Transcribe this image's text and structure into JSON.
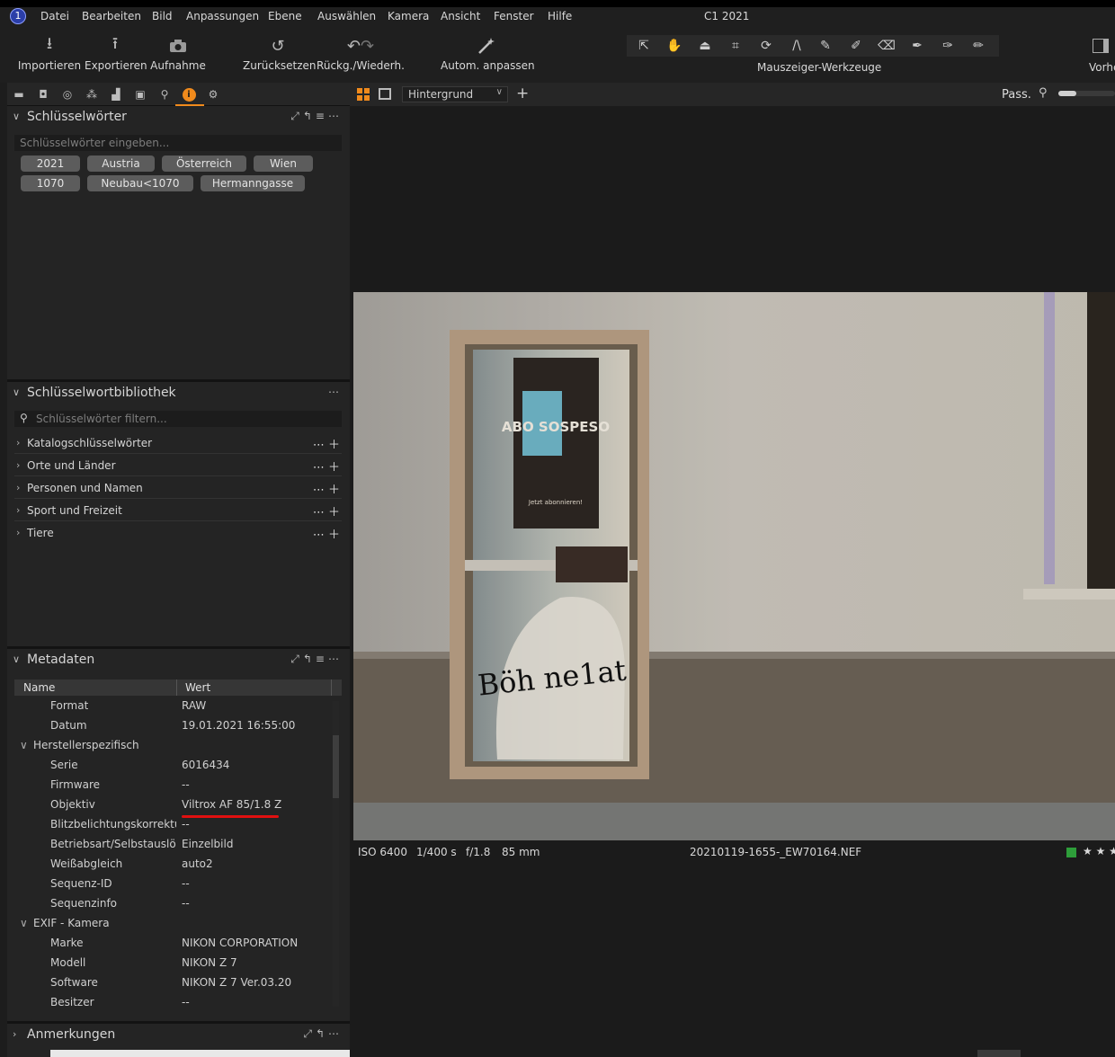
{
  "app": {
    "title": "C1 2021",
    "badge": "1"
  },
  "menu": [
    "Datei",
    "Bearbeiten",
    "Bild",
    "Anpassungen",
    "Ebene",
    "Auswählen",
    "Kamera",
    "Ansicht",
    "Fenster",
    "Hilfe"
  ],
  "toolbar": {
    "import": "Importieren",
    "export": "Exportieren",
    "capture": "Aufnahme",
    "reset": "Zurücksetzen",
    "undo_redo": "Rückg./Wiederh.",
    "auto_adjust": "Autom. anpassen",
    "cursor_tools": "Mauszeiger-Werkzeuge",
    "preview": "Vorhe"
  },
  "keywords": {
    "title": "Schlüsselwörter",
    "placeholder": "Schlüsselwörter eingeben...",
    "tags": [
      "2021",
      "Austria",
      "Österreich",
      "Wien",
      "1070",
      "Neubau<1070",
      "Hermanngasse"
    ]
  },
  "library": {
    "title": "Schlüsselwortbibliothek",
    "placeholder": "Schlüsselwörter filtern...",
    "items": [
      "Katalogschlüsselwörter",
      "Orte und Länder",
      "Personen und Namen",
      "Sport und Freizeit",
      "Tiere"
    ]
  },
  "metadata": {
    "title": "Metadaten",
    "col_name": "Name",
    "col_value": "Wert",
    "rows": [
      {
        "name": "Format",
        "value": "RAW"
      },
      {
        "name": "Datum",
        "value": "19.01.2021 16:55:00"
      },
      {
        "group": "Herstellerspezifisch"
      },
      {
        "name": "Serie",
        "value": "6016434"
      },
      {
        "name": "Firmware",
        "value": "--"
      },
      {
        "name": "Objektiv",
        "value": "Viltrox AF 85/1.8 Z"
      },
      {
        "name": "Blitzbelichtungskorrektur",
        "value": "--"
      },
      {
        "name": "Betriebsart/Selbstauslö...",
        "value": "Einzelbild"
      },
      {
        "name": "Weißabgleich",
        "value": "auto2"
      },
      {
        "name": "Sequenz-ID",
        "value": "--"
      },
      {
        "name": "Sequenzinfo",
        "value": "--"
      },
      {
        "group": "EXIF - Kamera"
      },
      {
        "name": "Marke",
        "value": "NIKON CORPORATION"
      },
      {
        "name": "Modell",
        "value": "NIKON Z 7"
      },
      {
        "name": "Software",
        "value": "NIKON Z 7 Ver.03.20"
      },
      {
        "name": "Besitzer",
        "value": "--"
      }
    ]
  },
  "notes": {
    "title": "Anmerkungen"
  },
  "viewer": {
    "layer": "Hintergrund",
    "fit": "Pass.",
    "iso": "ISO 6400",
    "shutter": "1/400 s",
    "aperture": "f/1.8",
    "focal": "85 mm",
    "filename": "20210119-1655-_EW70164.NEF",
    "rating": "★ ★ ★",
    "label_color": "#2e9e3a"
  },
  "photo_text": {
    "poster_title": "ABO SOSPESO",
    "poster_footer": "Jetzt abonnieren!",
    "graffiti": "Böh ne1at"
  },
  "colors": {
    "accent": "#f08a1c",
    "annotation": "#e01010"
  }
}
